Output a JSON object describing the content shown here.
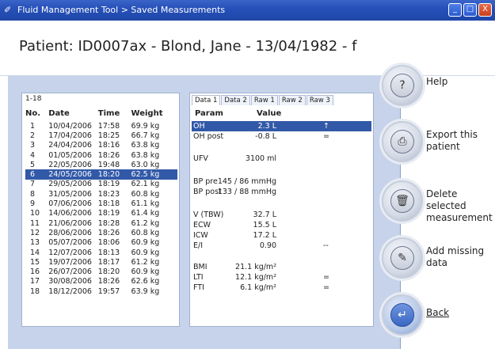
{
  "window": {
    "title": "Fluid Management Tool > Saved Measurements",
    "buttons": [
      "_",
      "□",
      "X"
    ]
  },
  "header": {
    "patient_title": "Patient: ID0007ax - Blond, Jane - 13/04/1982 - f"
  },
  "measurements": {
    "range_tab": "1-18",
    "columns": [
      "No.",
      "Date",
      "Time",
      "Weight"
    ],
    "rows": [
      [
        "1",
        "10/04/2006",
        "17:58",
        "69.9 kg"
      ],
      [
        "2",
        "17/04/2006",
        "18:25",
        "66.7 kg"
      ],
      [
        "3",
        "24/04/2006",
        "18:16",
        "63.8 kg"
      ],
      [
        "4",
        "01/05/2006",
        "18:26",
        "63.8 kg"
      ],
      [
        "5",
        "22/05/2006",
        "19:48",
        "63.0 kg"
      ],
      [
        "6",
        "24/05/2006",
        "18:20",
        "62.5 kg"
      ],
      [
        "7",
        "29/05/2006",
        "18:19",
        "62.1 kg"
      ],
      [
        "8",
        "31/05/2006",
        "18:23",
        "60.8 kg"
      ],
      [
        "9",
        "07/06/2006",
        "18:18",
        "61.1 kg"
      ],
      [
        "10",
        "14/06/2006",
        "18:19",
        "61.4 kg"
      ],
      [
        "11",
        "21/06/2006",
        "18:28",
        "61.2 kg"
      ],
      [
        "12",
        "28/06/2006",
        "18:26",
        "60.8 kg"
      ],
      [
        "13",
        "05/07/2006",
        "18:06",
        "60.9 kg"
      ],
      [
        "14",
        "12/07/2006",
        "18:13",
        "60.9 kg"
      ],
      [
        "15",
        "19/07/2006",
        "18:17",
        "61.2 kg"
      ],
      [
        "16",
        "26/07/2006",
        "18:20",
        "60.9 kg"
      ],
      [
        "17",
        "30/08/2006",
        "18:26",
        "62.6 kg"
      ],
      [
        "18",
        "18/12/2006",
        "19:57",
        "63.9 kg"
      ]
    ],
    "selected_row": 6
  },
  "data_panel": {
    "tabs": [
      "Data 1",
      "Data 2",
      "Raw 1",
      "Raw 2",
      "Raw 3"
    ],
    "active_tab": "Data 1",
    "col_param": "Param",
    "col_value": "Value",
    "rows": [
      {
        "param": "OH",
        "value": "2.3 L",
        "mark": "↑",
        "selected": true
      },
      {
        "param": "OH post",
        "value": "-0.8 L",
        "mark": "="
      },
      {
        "param": "UFV",
        "value": "3100 ml",
        "mark": ""
      },
      {
        "param": "BP pre",
        "value": "145 / 86 mmHg",
        "mark": ""
      },
      {
        "param": "BP post",
        "value": "133 / 88 mmHg",
        "mark": ""
      },
      {
        "param": "V (TBW)",
        "value": "32.7 L",
        "mark": ""
      },
      {
        "param": "ECW",
        "value": "15.5 L",
        "mark": ""
      },
      {
        "param": "ICW",
        "value": "17.2 L",
        "mark": ""
      },
      {
        "param": "E/I",
        "value": "0.90",
        "mark": "--"
      },
      {
        "param": "BMI",
        "value": "21.1 kg/m²",
        "mark": ""
      },
      {
        "param": "LTI",
        "value": "12.1 kg/m²",
        "mark": "="
      },
      {
        "param": "FTI",
        "value": "6.1 kg/m²",
        "mark": "="
      }
    ]
  },
  "actions": {
    "help": "Help",
    "export": "Export this\npatient",
    "delete": "Delete selected\nmeasurement",
    "add": "Add missing\ndata",
    "back": "Back"
  }
}
